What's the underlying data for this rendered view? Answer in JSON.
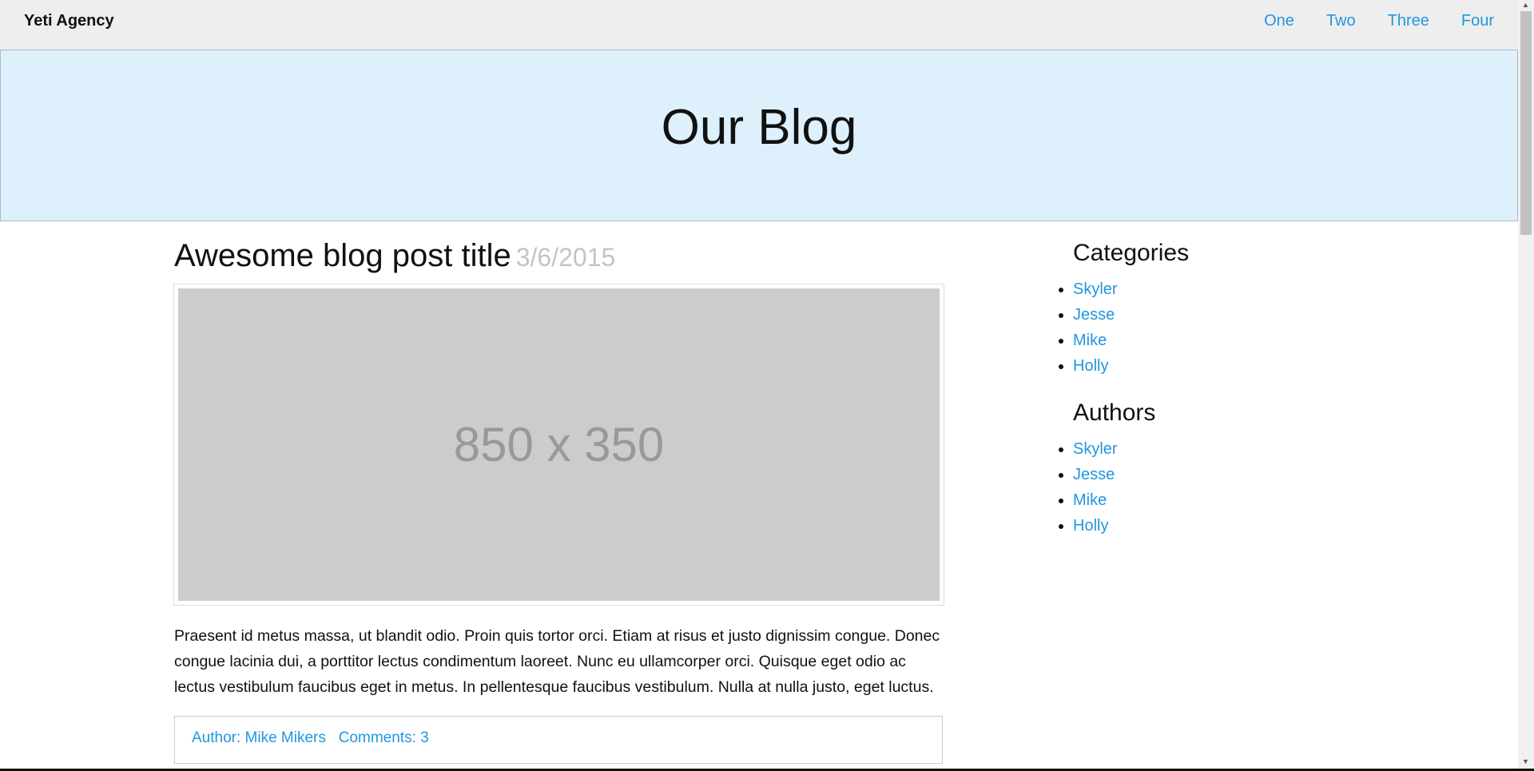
{
  "nav": {
    "brand": "Yeti Agency",
    "links": [
      "One",
      "Two",
      "Three",
      "Four"
    ]
  },
  "hero": {
    "title": "Our Blog"
  },
  "post": {
    "title": "Awesome blog post title",
    "date": "3/6/2015",
    "image_placeholder": "850 x 350",
    "body": "Praesent id metus massa, ut blandit odio. Proin quis tortor orci. Etiam at risus et justo dignissim congue. Donec congue lacinia dui, a porttitor lectus condimentum laoreet. Nunc eu ullamcorper orci. Quisque eget odio ac lectus vestibulum faucibus eget in metus. In pellentesque faucibus vestibulum. Nulla at nulla justo, eget luctus.",
    "author": "Author: Mike Mikers",
    "comments": "Comments: 3"
  },
  "sidebar": {
    "categories_title": "Categories",
    "categories": [
      "Skyler",
      "Jesse",
      "Mike",
      "Holly"
    ],
    "authors_title": "Authors",
    "authors": [
      "Skyler",
      "Jesse",
      "Mike",
      "Holly"
    ]
  }
}
